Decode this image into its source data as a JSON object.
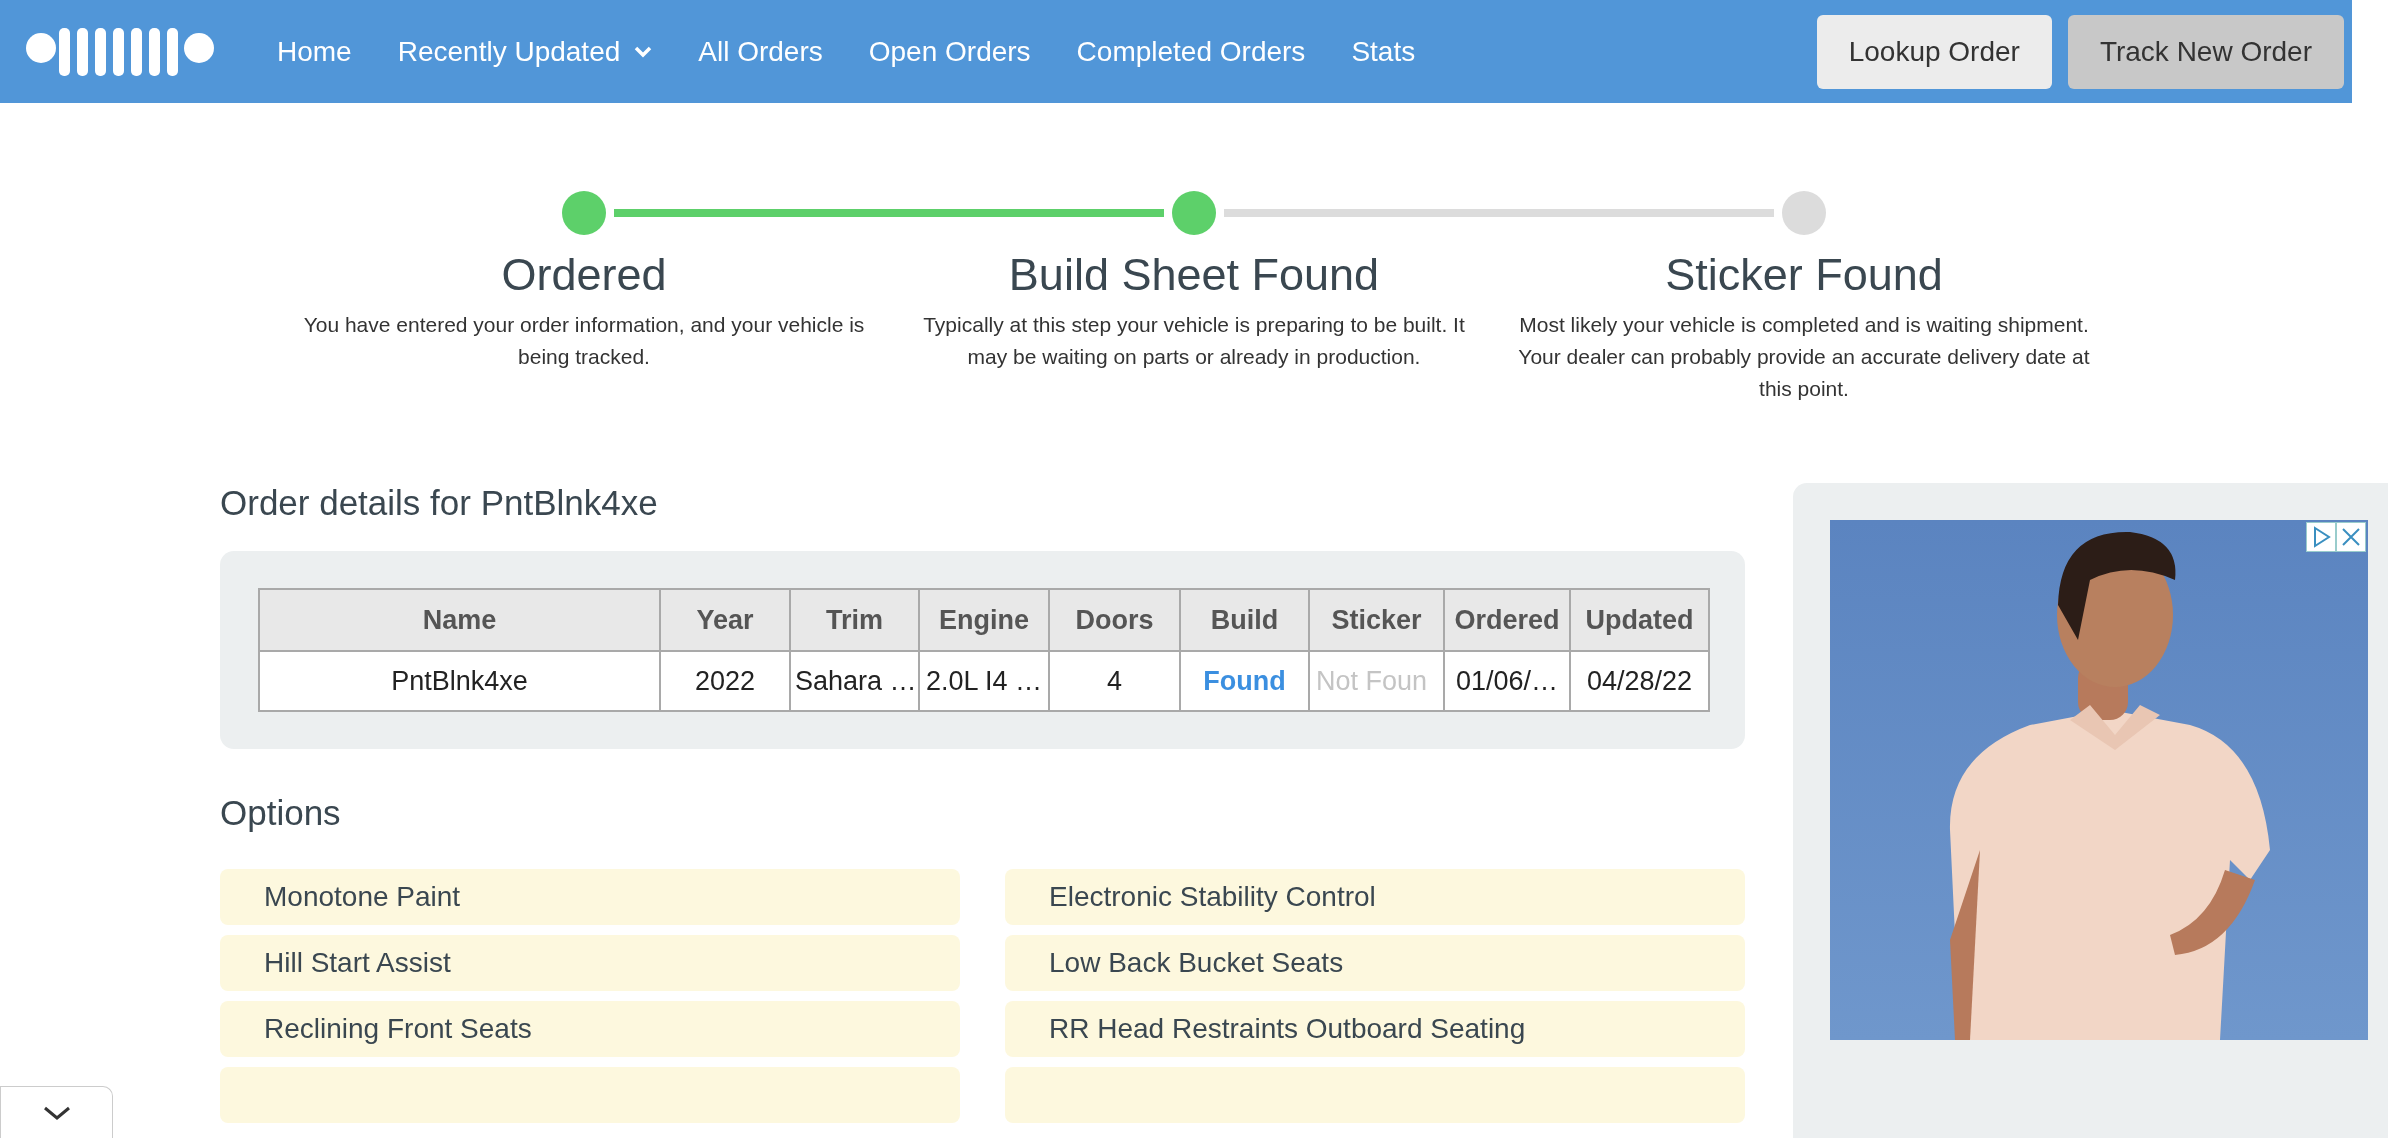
{
  "nav": {
    "items": [
      {
        "label": "Home",
        "dropdown": false
      },
      {
        "label": "Recently Updated",
        "dropdown": true
      },
      {
        "label": "All Orders",
        "dropdown": false
      },
      {
        "label": "Open Orders",
        "dropdown": false
      },
      {
        "label": "Completed Orders",
        "dropdown": false
      },
      {
        "label": "Stats",
        "dropdown": false
      }
    ],
    "buttons": [
      {
        "label": "Lookup Order",
        "kind": "light"
      },
      {
        "label": "Track New Order",
        "kind": "grey"
      }
    ]
  },
  "steps": [
    {
      "title": "Ordered",
      "description": "You have entered your order information, and your vehicle is being tracked.",
      "done": true
    },
    {
      "title": "Build Sheet Found",
      "description": "Typically at this step your vehicle is preparing to be built. It may be waiting on parts or already in production.",
      "done": true
    },
    {
      "title": "Sticker Found",
      "description": "Most likely your vehicle is completed and is waiting shipment. Your dealer can probably provide an accurate delivery date at this point.",
      "done": false
    }
  ],
  "order_heading": "Order details for PntBlnk4xe",
  "table": {
    "columns": [
      "Name",
      "Year",
      "Trim",
      "Engine",
      "Doors",
      "Build",
      "Sticker",
      "Ordered",
      "Updated"
    ],
    "rows": [
      [
        {
          "text": "PntBlnk4xe",
          "kind": "plain"
        },
        {
          "text": "2022",
          "kind": "plain"
        },
        {
          "text": "Sahara …",
          "kind": "plain"
        },
        {
          "text": "2.0L I4 …",
          "kind": "plain"
        },
        {
          "text": "4",
          "kind": "plain"
        },
        {
          "text": "Found",
          "kind": "found"
        },
        {
          "text": "Not Foun",
          "kind": "missing"
        },
        {
          "text": "01/06/…",
          "kind": "plain"
        },
        {
          "text": "04/28/22",
          "kind": "plain"
        }
      ]
    ]
  },
  "options_heading": "Options",
  "options": [
    "Monotone Paint",
    "Electronic Stability Control",
    "Hill Start Assist",
    "Low Back Bucket Seats",
    "Reclining Front Seats",
    "RR Head Restraints Outboard Seating"
  ]
}
